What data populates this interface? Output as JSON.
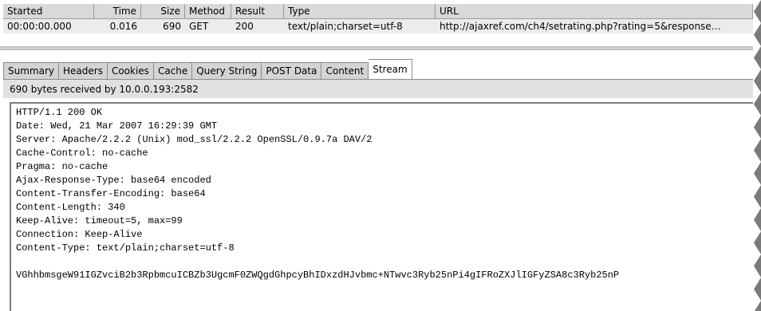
{
  "grid": {
    "headers": [
      "Started",
      "Time",
      "Size",
      "Method",
      "Result",
      "Type",
      "URL"
    ],
    "row": [
      "00:00:00.000",
      "0.016",
      "690",
      "GET",
      "200",
      "text/plain;charset=utf-8",
      "http://ajaxref.com/ch4/setrating.php?rating=5&response…"
    ]
  },
  "tabs": [
    "Summary",
    "Headers",
    "Cookies",
    "Cache",
    "Query String",
    "POST Data",
    "Content",
    "Stream"
  ],
  "active_tab": "Stream",
  "info": "690 bytes received by 10.0.0.193:2582",
  "stream_lines": [
    "HTTP/1.1 200 OK",
    "Date: Wed, 21 Mar 2007 16:29:39 GMT",
    "Server: Apache/2.2.2 (Unix) mod_ssl/2.2.2 OpenSSL/0.9.7a DAV/2",
    "Cache-Control: no-cache",
    "Pragma: no-cache",
    "Ajax-Response-Type: base64 encoded",
    "Content-Transfer-Encoding: base64",
    "Content-Length: 340",
    "Keep-Alive: timeout=5, max=99",
    "Connection: Keep-Alive",
    "Content-Type: text/plain;charset=utf-8",
    "",
    "VGhhbmsgeW91IGZvciB2b3RpbmcuICBZb3UgcmF0ZWQgdGhpcyBhIDxzdHJvbmc+NTwvc3Ryb25nPi4gIFRoZXJlIGFyZSA8c3Ryb25nP"
  ]
}
